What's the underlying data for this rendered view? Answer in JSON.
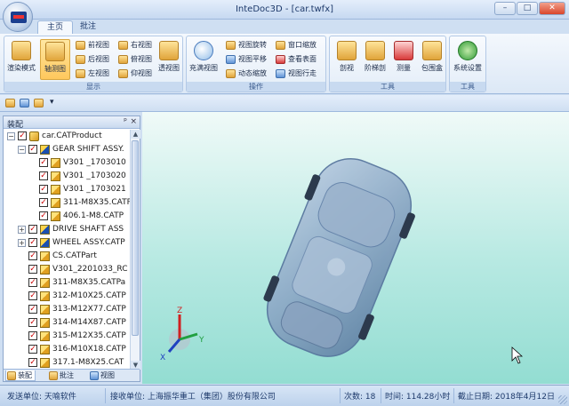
{
  "window": {
    "title": "InteDoc3D - [car.twfx]",
    "controls": {
      "minimize": "–",
      "maximize": "□",
      "close": "✕"
    }
  },
  "ribbon": {
    "tabs": [
      {
        "label": "主页",
        "active": true
      },
      {
        "label": "批注",
        "active": false
      }
    ],
    "groups": {
      "display": {
        "label": "显示",
        "render_mode": "渲染模式",
        "axis_view": "轴测图",
        "front_view": "前视图",
        "back_view": "后视图",
        "left_view": "左视图",
        "right_view": "右视图",
        "top_view": "俯视图",
        "bottom_view": "仰视图",
        "perspective": "透视图"
      },
      "operation": {
        "label": "操作",
        "fit_view": "充满视图",
        "rotate": "视图旋转",
        "pan": "视图平移",
        "dynamic_zoom": "动态缩放",
        "window_zoom": "窗口缩放",
        "view_surface": "查看表面",
        "walk": "视图行走"
      },
      "tools": {
        "label": "工具",
        "section": "剖视",
        "step_explode": "阶梯剖",
        "measure": "测量",
        "bbox": "包围盒"
      },
      "tools2": {
        "label": "工具",
        "settings": "系统设置"
      }
    }
  },
  "qat": {
    "more": "▾"
  },
  "assembly_panel": {
    "title": "装配",
    "pin": "ᵖ",
    "close": "×",
    "tree": [
      {
        "label": "car.CATProduct",
        "level": 0,
        "type": "prod",
        "expander": "−"
      },
      {
        "label": "GEAR SHIFT ASSY.",
        "level": 1,
        "type": "assy",
        "expander": "−"
      },
      {
        "label": "V301 _1703010",
        "level": 2,
        "type": "part",
        "expander": ""
      },
      {
        "label": "V301 _1703020",
        "level": 2,
        "type": "part",
        "expander": ""
      },
      {
        "label": "V301 _1703021",
        "level": 2,
        "type": "part",
        "expander": ""
      },
      {
        "label": "311-M8X35.CATP",
        "level": 2,
        "type": "part",
        "expander": ""
      },
      {
        "label": "406.1-M8.CATP",
        "level": 2,
        "type": "part",
        "expander": ""
      },
      {
        "label": "DRIVE SHAFT ASS",
        "level": 1,
        "type": "assy",
        "expander": "+"
      },
      {
        "label": "WHEEL ASSY.CATP",
        "level": 1,
        "type": "assy",
        "expander": "+"
      },
      {
        "label": "CS.CATPart",
        "level": 1,
        "type": "part",
        "expander": ""
      },
      {
        "label": "V301_2201033_RC",
        "level": 1,
        "type": "part",
        "expander": ""
      },
      {
        "label": "311-M8X35.CATPa",
        "level": 1,
        "type": "part",
        "expander": ""
      },
      {
        "label": "312-M10X25.CATP",
        "level": 1,
        "type": "part",
        "expander": ""
      },
      {
        "label": "313-M12X77.CATP",
        "level": 1,
        "type": "part",
        "expander": ""
      },
      {
        "label": "314-M14X87.CATP",
        "level": 1,
        "type": "part",
        "expander": ""
      },
      {
        "label": "315-M12X35.CATP",
        "level": 1,
        "type": "part",
        "expander": ""
      },
      {
        "label": "316-M10X18.CATP",
        "level": 1,
        "type": "part",
        "expander": ""
      },
      {
        "label": "317.1-M8X25.CAT",
        "level": 1,
        "type": "part",
        "expander": ""
      }
    ],
    "tabs": [
      {
        "label": "装配",
        "active": true
      },
      {
        "label": "批注",
        "active": false
      },
      {
        "label": "视图",
        "active": false
      }
    ]
  },
  "viewport": {
    "axes": {
      "x": "X",
      "y": "Y",
      "z": "Z"
    },
    "colors": {
      "bg_top": "#f0faf8",
      "bg_bottom": "#93ddd2",
      "car": "#7f9cbc"
    }
  },
  "status": {
    "sender": "发送单位: 天喻软件",
    "receiver": "接收单位: 上海振华重工（集团）股份有限公司",
    "count": "次数: 18",
    "time": "时间: 114.28小时",
    "deadline": "截止日期: 2018年4月12日"
  }
}
